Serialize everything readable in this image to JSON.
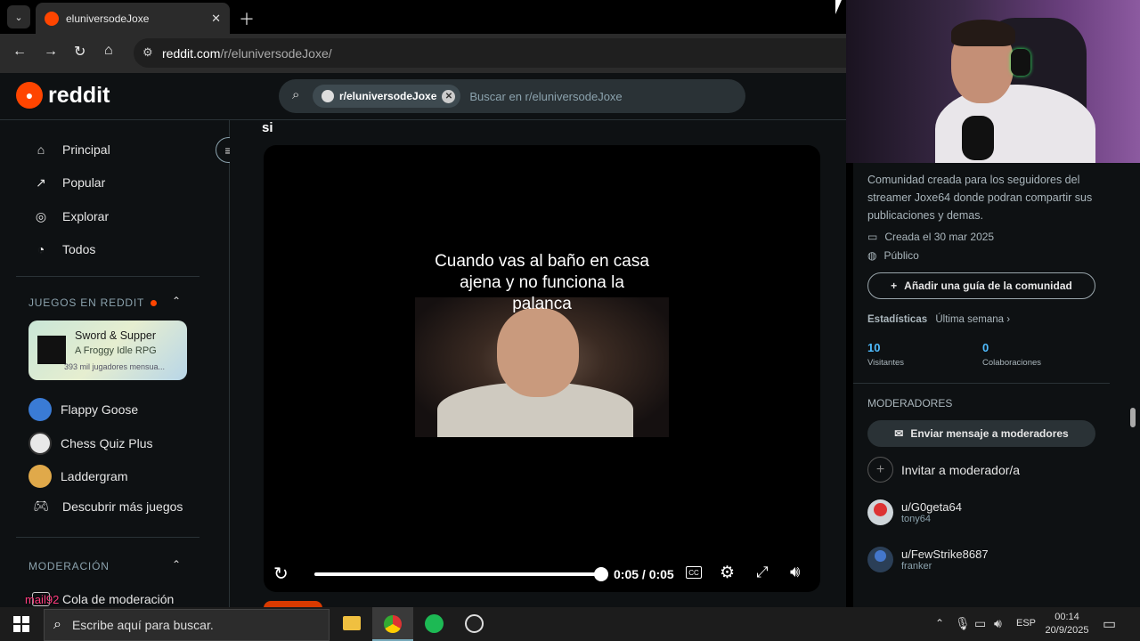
{
  "browser": {
    "tab_title": "eluniversodeJoxe",
    "url_domain": "reddit.com",
    "url_path": "/r/eluniversodeJoxe/"
  },
  "reddit": {
    "logo_text": "reddit",
    "search_chip": "r/eluniversodeJoxe",
    "search_placeholder": "Buscar en r/eluniversodeJoxe"
  },
  "sidebar": {
    "nav": [
      {
        "label": "Principal",
        "icon": "home-icon"
      },
      {
        "label": "Popular",
        "icon": "popular-icon"
      },
      {
        "label": "Explorar",
        "icon": "explore-icon"
      },
      {
        "label": "Todos",
        "icon": "all-icon"
      }
    ],
    "games_header": "JUEGOS EN REDDIT",
    "featured": {
      "title": "Sword & Supper",
      "subtitle": "A Froggy Idle RPG",
      "players": "393 mil jugadores mensua..."
    },
    "games": [
      "Flappy Goose",
      "Chess Quiz Plus",
      "Laddergram",
      "Descubrir más juegos"
    ],
    "mod_header": "MODERACIÓN",
    "mod_item": "Cola de moderación",
    "overlay_user": "mail92"
  },
  "post": {
    "title_fragment": "si",
    "caption": "Cuando vas al baño en casa ajena y no funciona la palanca",
    "time": "0:05 / 0:05",
    "progress": 1.0
  },
  "community": {
    "description": "Comunidad creada para los seguidores del streamer Joxe64 donde podran compartir sus publicaciones y demas.",
    "created": "Creada el 30 mar 2025",
    "visibility": "Público",
    "guide_button": "Añadir una guía de la comunidad",
    "stats_label": "Estadísticas",
    "stats_period": "Última semana ›",
    "visitors_value": "10",
    "visitors_label": "Visitantes",
    "contrib_value": "0",
    "contrib_label": "Colaboraciones",
    "mods_header": "MODERADORES",
    "message_button": "Enviar mensaje a moderadores",
    "invite_label": "Invitar a moderador/a",
    "mods": [
      {
        "name": "u/G0geta64",
        "flair": "tony64"
      },
      {
        "name": "u/FewStrike8687",
        "flair": "franker"
      }
    ]
  },
  "taskbar": {
    "search_placeholder": "Escribe aquí para buscar.",
    "lang": "ESP",
    "time": "00:14",
    "date": "20/9/2025"
  },
  "colors": {
    "accent": "#ff4500",
    "bg": "#0e1113",
    "chip": "#3e4a50",
    "link": "#4fbcff"
  }
}
